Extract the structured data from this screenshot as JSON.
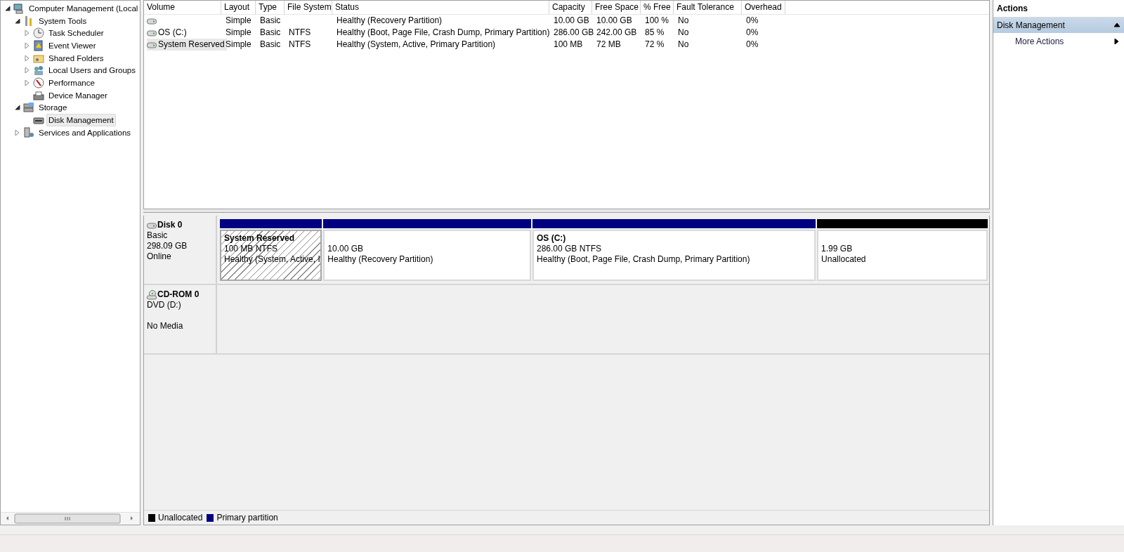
{
  "tree": [
    {
      "label": "Computer Management (Local",
      "expanded": true,
      "selected": false,
      "children": [
        {
          "label": "System Tools",
          "expanded": true,
          "selected": false,
          "children": [
            {
              "label": "Task Scheduler",
              "expanded": false,
              "selected": false
            },
            {
              "label": "Event Viewer",
              "expanded": false,
              "selected": false
            },
            {
              "label": "Shared Folders",
              "expanded": false,
              "selected": false
            },
            {
              "label": "Local Users and Groups",
              "expanded": false,
              "selected": false
            },
            {
              "label": "Performance",
              "expanded": false,
              "selected": false
            },
            {
              "label": "Device Manager",
              "selected": false
            }
          ]
        },
        {
          "label": "Storage",
          "expanded": true,
          "selected": false,
          "children": [
            {
              "label": "Disk Management",
              "selected": true
            }
          ]
        },
        {
          "label": "Services and Applications",
          "expanded": false,
          "selected": false
        }
      ]
    }
  ],
  "table": {
    "columns": [
      "Volume",
      "Layout",
      "Type",
      "File System",
      "Status",
      "Capacity",
      "Free Space",
      "% Free",
      "Fault Tolerance",
      "Overhead"
    ],
    "rows": [
      {
        "selected": false,
        "cells": [
          "",
          "Simple",
          "Basic",
          "",
          "Healthy (Recovery Partition)",
          "10.00 GB",
          "10.00 GB",
          "100 %",
          "No",
          "0%"
        ]
      },
      {
        "selected": false,
        "cells": [
          "OS (C:)",
          "Simple",
          "Basic",
          "NTFS",
          "Healthy (Boot, Page File, Crash Dump, Primary Partition)",
          "286.00 GB",
          "242.00 GB",
          "85 %",
          "No",
          "0%"
        ]
      },
      {
        "selected": true,
        "cells": [
          "System Reserved",
          "Simple",
          "Basic",
          "NTFS",
          "Healthy (System, Active, Primary Partition)",
          "100 MB",
          "72 MB",
          "72 %",
          "No",
          "0%"
        ]
      }
    ]
  },
  "disks": [
    {
      "kind": "disk",
      "name": "Disk 0",
      "type": "Basic",
      "size": "298.09 GB",
      "status": "Online",
      "partitions": [
        {
          "kind": "primary",
          "selected": true,
          "title": "System Reserved",
          "size": "100 MB NTFS",
          "status": "Healthy (System, Active, I"
        },
        {
          "kind": "primary",
          "selected": false,
          "size": "10.00 GB",
          "status": "Healthy (Recovery Partition)"
        },
        {
          "kind": "primary",
          "selected": false,
          "title": "OS  (C:)",
          "size": "286.00 GB NTFS",
          "status": "Healthy (Boot, Page File, Crash Dump, Primary Partition)"
        },
        {
          "kind": "unallocated",
          "selected": false,
          "size": "1.99 GB",
          "status": "Unallocated"
        }
      ]
    },
    {
      "kind": "cdrom",
      "name": "CD-ROM 0",
      "type": "DVD (D:)",
      "status": "No Media"
    }
  ],
  "legend": [
    {
      "label": "Unallocated",
      "color": "#000000"
    },
    {
      "label": "Primary partition",
      "color": "#000080"
    }
  ],
  "actions": {
    "title": "Actions",
    "section": {
      "label": "Disk Management",
      "expanded": true
    },
    "items": [
      "More Actions"
    ]
  }
}
